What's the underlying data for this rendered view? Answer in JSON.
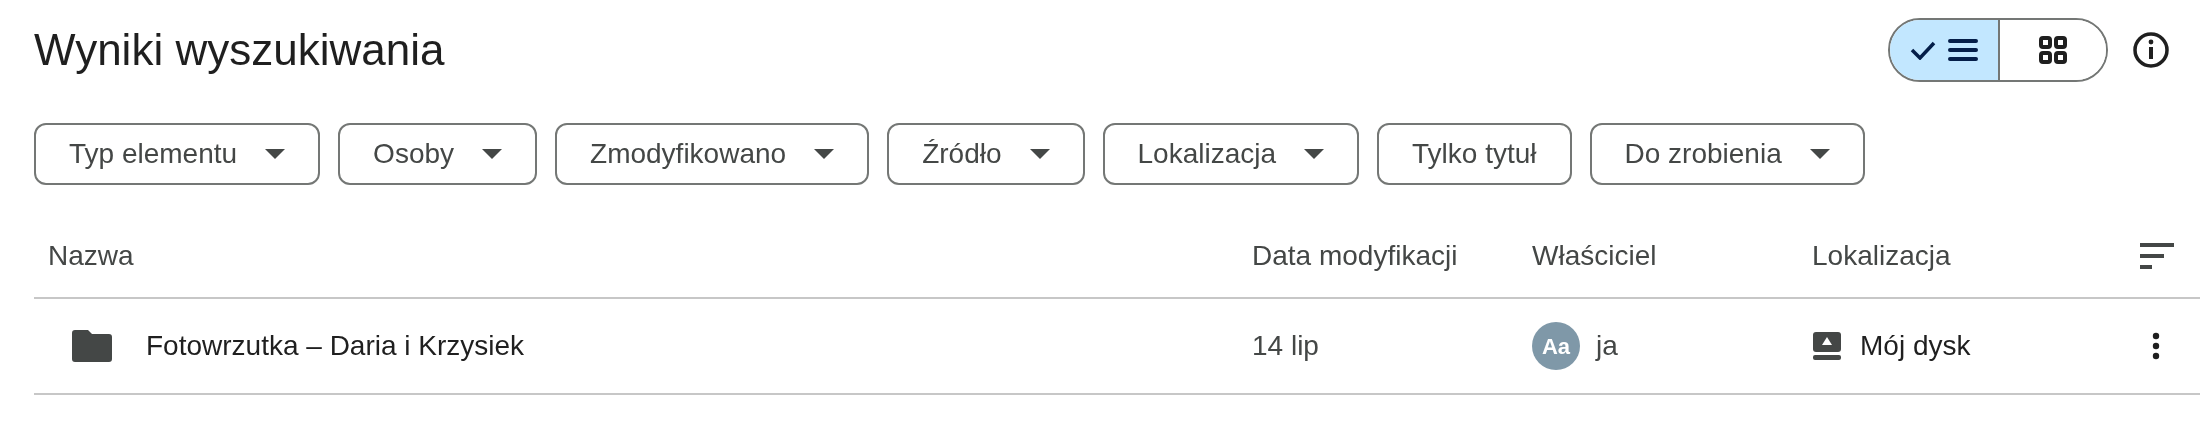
{
  "title": "Wyniki wyszukiwania",
  "view_toggle": [
    {
      "kind": "list",
      "selected": true
    },
    {
      "kind": "grid",
      "selected": false
    }
  ],
  "filters": [
    {
      "label": "Typ elementu",
      "dropdown": true
    },
    {
      "label": "Osoby",
      "dropdown": true
    },
    {
      "label": "Zmodyfikowano",
      "dropdown": true
    },
    {
      "label": "Źródło",
      "dropdown": true
    },
    {
      "label": "Lokalizacja",
      "dropdown": true
    },
    {
      "label": "Tylko tytuł",
      "dropdown": false
    },
    {
      "label": "Do zrobienia",
      "dropdown": true
    }
  ],
  "table": {
    "columns": [
      "Nazwa",
      "Data modyfikacji",
      "Właściciel",
      "Lokalizacja"
    ],
    "rows": [
      {
        "name": "Fotowrzutka – Daria i Krzysiek",
        "modified": "14 lip",
        "owner_initials": "Aa",
        "owner": "ja",
        "location": "Mój dysk"
      }
    ]
  }
}
